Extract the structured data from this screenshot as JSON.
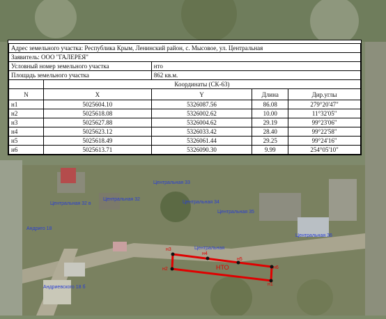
{
  "header": {
    "address": "Адрес земельного участка: Республика Крым, Ленинский район, с. Мысовое, ул. Центральная",
    "applicant": "Заявитель: ООО \"ГАЛЕРЕЯ\"",
    "cond_number_label": "Условный номер земельного участка",
    "cond_number_value": "нто",
    "area_label": "Площадь земельного участка",
    "area_value": "862 кв.м."
  },
  "table": {
    "coords_title": "Координаты (СК-63)",
    "col_n": "N",
    "col_x": "X",
    "col_y": "Y",
    "col_length": "Длина",
    "col_angle": "Дир.углы",
    "points": [
      {
        "n": "н1",
        "x": "5025604.10",
        "y": "5326087.56"
      },
      {
        "n": "н2",
        "x": "5025618.08",
        "y": "5326002.62"
      },
      {
        "n": "н3",
        "x": "5025627.88",
        "y": "5326004.62"
      },
      {
        "n": "н4",
        "x": "5025623.12",
        "y": "5326033.42"
      },
      {
        "n": "н5",
        "x": "5025618.49",
        "y": "5326061.44"
      },
      {
        "n": "н6",
        "x": "5025613.71",
        "y": "5326090.30"
      }
    ],
    "segments": [
      {
        "len": "86.08",
        "angle": "279°20'47\""
      },
      {
        "len": "10.00",
        "angle": "11°32'05\""
      },
      {
        "len": "29.19",
        "angle": "99°23'06\""
      },
      {
        "len": "28.40",
        "angle": "99°22'58\""
      },
      {
        "len": "29.25",
        "angle": "99°24'16\""
      },
      {
        "len": "9.99",
        "angle": "254°05'10\""
      }
    ]
  },
  "map": {
    "labels": {
      "c33": "Центральная 33",
      "c32v": "Центральная 32 в",
      "c32": "Центральная 32",
      "c34": "Центральная 34",
      "c35": "Центральная 35",
      "c36": "Центральная 36",
      "andr18": "Андриго 18",
      "andr18b": "Андриевского 18 б",
      "street": "Центральная"
    },
    "parcel_label": "НТО",
    "points": {
      "p1": "н1",
      "p2": "н2",
      "p3": "н3",
      "p4": "н4",
      "p5": "н5",
      "p6": "н6"
    }
  },
  "colors": {
    "parcel": "#e00000",
    "labels": "#2a3fd1"
  }
}
